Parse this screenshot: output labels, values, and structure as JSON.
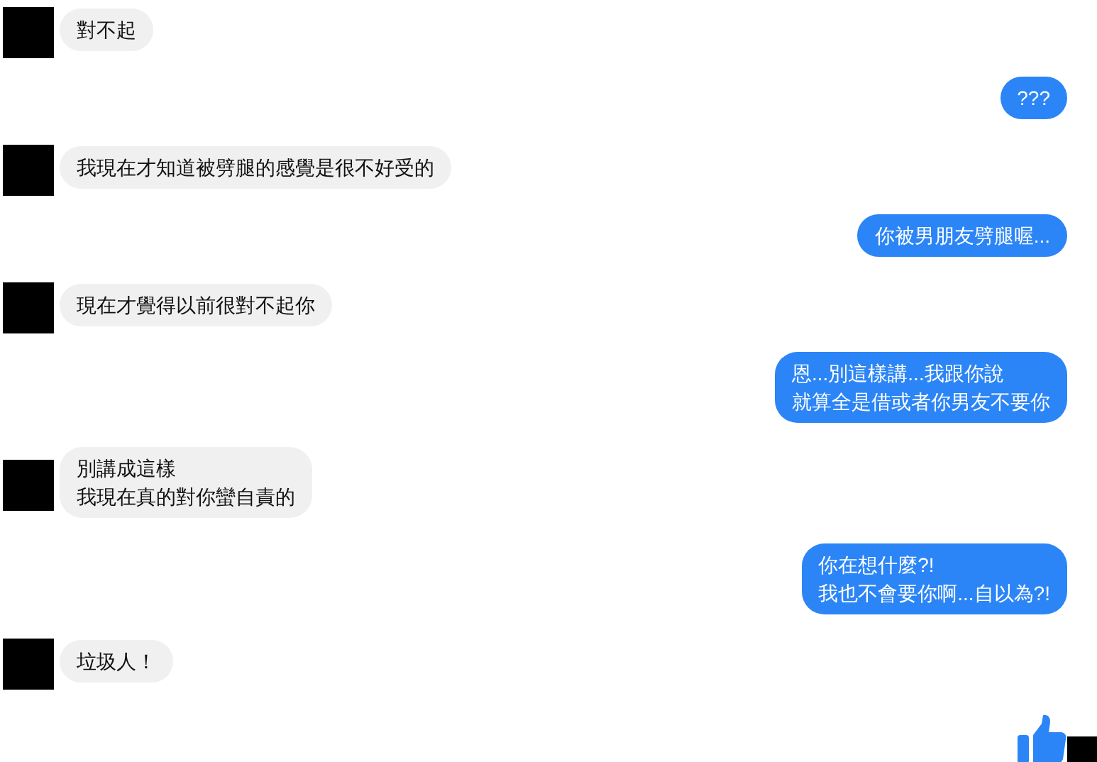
{
  "messages": [
    {
      "kind": "incoming",
      "lines": [
        "對不起"
      ]
    },
    {
      "kind": "outgoing",
      "lines": [
        "???"
      ]
    },
    {
      "kind": "incoming",
      "lines": [
        "我現在才知道被劈腿的感覺是很不好受的"
      ]
    },
    {
      "kind": "outgoing",
      "lines": [
        "你被男朋友劈腿喔..."
      ]
    },
    {
      "kind": "incoming",
      "lines": [
        "現在才覺得以前很對不起你"
      ]
    },
    {
      "kind": "outgoing",
      "lines": [
        "恩...別這樣講...我跟你說",
        "就算全是借或者你男友不要你"
      ]
    },
    {
      "kind": "incoming",
      "lines": [
        "別講成這樣",
        "我現在真的對你蠻自責的"
      ]
    },
    {
      "kind": "outgoing",
      "lines": [
        "你在想什麼?!",
        "我也不會要你啊...自以為?!"
      ]
    },
    {
      "kind": "incoming",
      "lines": [
        "垃圾人！"
      ]
    },
    {
      "kind": "like"
    }
  ]
}
